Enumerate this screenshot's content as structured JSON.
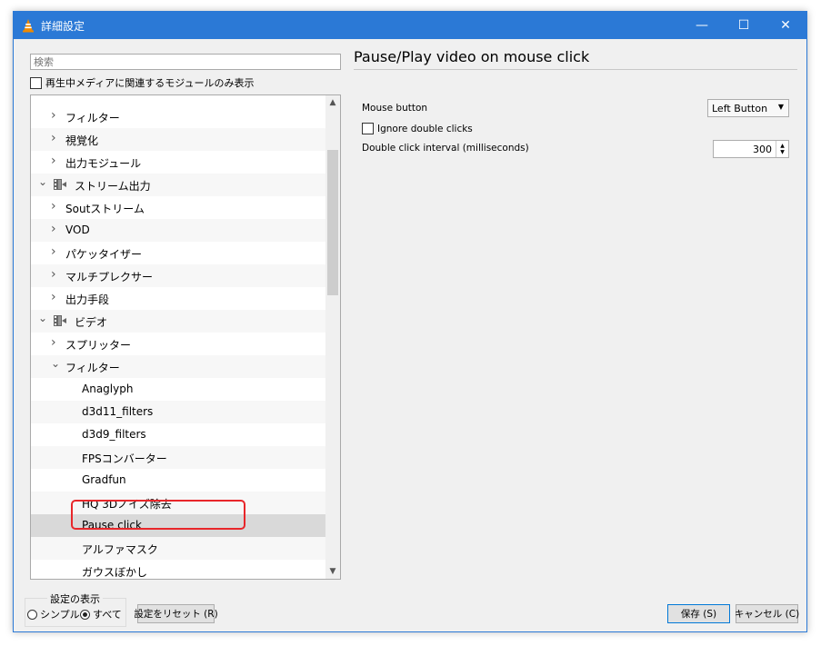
{
  "window": {
    "title": "詳細設定",
    "minimize": "—",
    "maximize": "☐",
    "close": "✕"
  },
  "search": {
    "placeholder": "検索"
  },
  "filter_checkbox": {
    "label": "再生中メディアに関連するモジュールのみ表示"
  },
  "tree": {
    "items": [
      {
        "label": "フィルター",
        "level": 1,
        "arrow": "›"
      },
      {
        "label": "視覚化",
        "level": 1,
        "arrow": "›"
      },
      {
        "label": "出力モジュール",
        "level": 1,
        "arrow": "›"
      },
      {
        "label": "ストリーム出力",
        "level": 0,
        "arrow": "⌄",
        "icon": "stream-output-icon"
      },
      {
        "label": "Soutストリーム",
        "level": 1,
        "arrow": "›"
      },
      {
        "label": "VOD",
        "level": 1,
        "arrow": "›"
      },
      {
        "label": "パケッタイザー",
        "level": 1,
        "arrow": "›"
      },
      {
        "label": "マルチプレクサー",
        "level": 1,
        "arrow": "›"
      },
      {
        "label": "出力手段",
        "level": 1,
        "arrow": "›"
      },
      {
        "label": "ビデオ",
        "level": 0,
        "arrow": "⌄",
        "icon": "video-icon"
      },
      {
        "label": "スプリッター",
        "level": 1,
        "arrow": "›"
      },
      {
        "label": "フィルター",
        "level": 1,
        "arrow": "⌄"
      },
      {
        "label": "Anaglyph",
        "level": 2
      },
      {
        "label": "d3d11_filters",
        "level": 2
      },
      {
        "label": "d3d9_filters",
        "level": 2
      },
      {
        "label": "FPSコンバーター",
        "level": 2
      },
      {
        "label": "Gradfun",
        "level": 2
      },
      {
        "label": "HQ 3Dノイズ除去",
        "level": 2
      },
      {
        "label": "Pause click",
        "level": 2,
        "selected": true
      },
      {
        "label": "アルファマスク",
        "level": 2
      },
      {
        "label": "ガウスぼかし",
        "level": 2
      }
    ]
  },
  "panel": {
    "title": "Pause/Play video on mouse click",
    "mouse_button_label": "Mouse button",
    "mouse_button_value": "Left Button",
    "ignore_double_label": "Ignore double clicks",
    "interval_label": "Double click interval (milliseconds)",
    "interval_value": "300"
  },
  "footer": {
    "group_label": "設定の表示",
    "simple_label": "シンプル",
    "all_label": "すべて",
    "reset_label": "設定をリセット (R)",
    "save_label": "保存 (S)",
    "cancel_label": "キャンセル (C)"
  },
  "colors": {
    "titlebar": "#2b79d6",
    "highlight": "#e8262a",
    "selected_row": "#d9d9d9"
  }
}
